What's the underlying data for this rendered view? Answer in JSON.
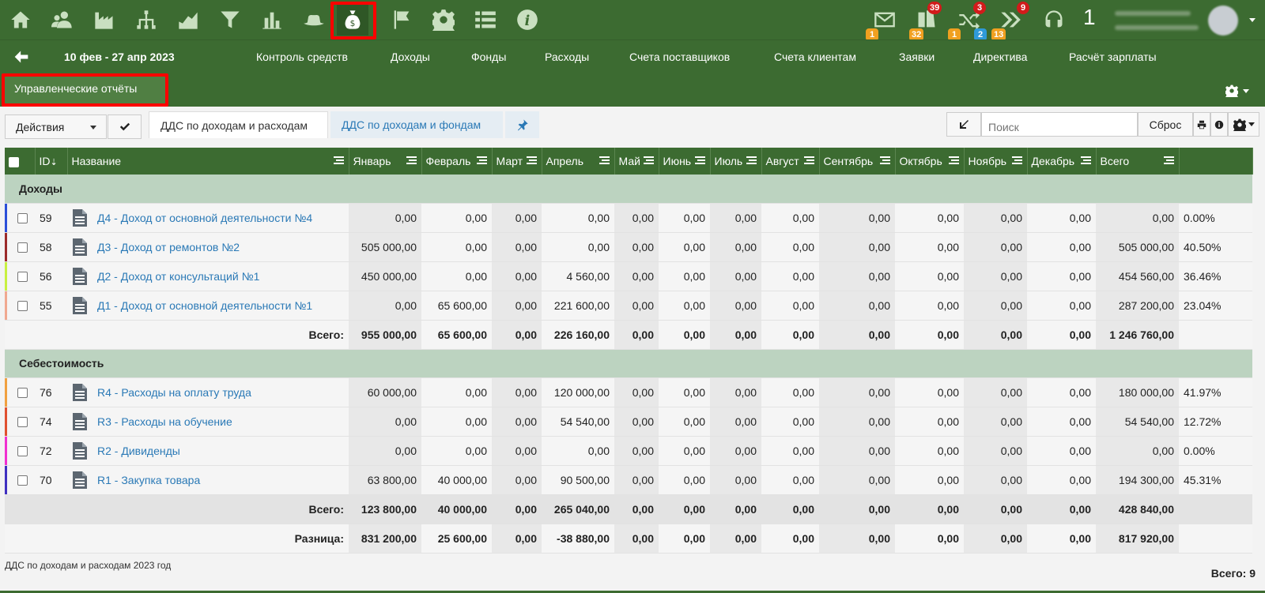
{
  "topbar": {
    "icons": [
      "home-icon",
      "users-icon",
      "factory-icon",
      "org-chart-icon",
      "area-chart-icon",
      "filter-icon",
      "bar-chart-icon",
      "hat-icon",
      "money-bag-icon",
      "flag-icon",
      "gear-icon",
      "list-icon",
      "info-icon"
    ],
    "active_icon": "money-bag-icon",
    "mail_badge": "1",
    "tasks_badge_top": "39",
    "tasks_badge_bottom": "32",
    "shuffle_badge_top": "3",
    "shuffle_badge_left": "1",
    "shuffle_badge_right": "2",
    "forward_badge_top": "9",
    "forward_badge_bottom": "13",
    "count": "1"
  },
  "nav": {
    "daterange": "10 фев - 27 апр 2023",
    "links": [
      "Контроль средств",
      "Доходы",
      "Фонды",
      "Расходы",
      "Счета поставщиков",
      "Счета клиентам",
      "Заявки",
      "Директива",
      "Расчёт зарплаты"
    ]
  },
  "subbar": {
    "tab": "Управленческие отчёты"
  },
  "toolbar": {
    "actions": "Действия",
    "tab1": "ДДС по доходам и расходам",
    "tab2": "ДДС по доходам и фондам",
    "search_placeholder": "Поиск",
    "reset": "Сброс"
  },
  "table": {
    "headers": [
      "ID",
      "Название",
      "Январь",
      "Февраль",
      "Март",
      "Апрель",
      "Май",
      "Июнь",
      "Июль",
      "Август",
      "Сентябрь",
      "Октябрь",
      "Ноябрь",
      "Декабрь",
      "Всего"
    ],
    "groups": [
      {
        "label": "Доходы",
        "rows": [
          {
            "id": "59",
            "name": "Д4 - Доход от основной деятельности №4",
            "color": "#2b4fd8",
            "values": [
              "0,00",
              "0,00",
              "0,00",
              "0,00",
              "0,00",
              "0,00",
              "0,00",
              "0,00",
              "0,00",
              "0,00",
              "0,00",
              "0,00",
              "0,00"
            ],
            "pct": "0.00%"
          },
          {
            "id": "58",
            "name": "Д3 - Доход от ремонтов №2",
            "color": "#9b2a2a",
            "values": [
              "505 000,00",
              "0,00",
              "0,00",
              "0,00",
              "0,00",
              "0,00",
              "0,00",
              "0,00",
              "0,00",
              "0,00",
              "0,00",
              "0,00",
              "505 000,00"
            ],
            "pct": "40.50%"
          },
          {
            "id": "56",
            "name": "Д2 - Доход от консультаций №1",
            "color": "#c8f040",
            "values": [
              "450 000,00",
              "0,00",
              "0,00",
              "4 560,00",
              "0,00",
              "0,00",
              "0,00",
              "0,00",
              "0,00",
              "0,00",
              "0,00",
              "0,00",
              "454 560,00"
            ],
            "pct": "36.46%"
          },
          {
            "id": "55",
            "name": "Д1 - Доход от основной деятельности №1",
            "color": "#f0a890",
            "values": [
              "0,00",
              "65 600,00",
              "0,00",
              "221 600,00",
              "0,00",
              "0,00",
              "0,00",
              "0,00",
              "0,00",
              "0,00",
              "0,00",
              "0,00",
              "287 200,00"
            ],
            "pct": "23.04%"
          }
        ],
        "total_label": "Всего:",
        "total": [
          "955 000,00",
          "65 600,00",
          "0,00",
          "226 160,00",
          "0,00",
          "0,00",
          "0,00",
          "0,00",
          "0,00",
          "0,00",
          "0,00",
          "0,00",
          "1 246 760,00"
        ]
      },
      {
        "label": "Себестоимость",
        "rows": [
          {
            "id": "76",
            "name": "R4 - Расходы на оплату труда",
            "color": "#f0a040",
            "values": [
              "60 000,00",
              "0,00",
              "0,00",
              "120 000,00",
              "0,00",
              "0,00",
              "0,00",
              "0,00",
              "0,00",
              "0,00",
              "0,00",
              "0,00",
              "180 000,00"
            ],
            "pct": "41.97%"
          },
          {
            "id": "74",
            "name": "R3 - Расходы на обучение",
            "color": "#e05030",
            "values": [
              "0,00",
              "0,00",
              "0,00",
              "54 540,00",
              "0,00",
              "0,00",
              "0,00",
              "0,00",
              "0,00",
              "0,00",
              "0,00",
              "0,00",
              "54 540,00"
            ],
            "pct": "12.72%"
          },
          {
            "id": "72",
            "name": "R2 - Дивиденды",
            "color": "#f030d0",
            "values": [
              "0,00",
              "0,00",
              "0,00",
              "0,00",
              "0,00",
              "0,00",
              "0,00",
              "0,00",
              "0,00",
              "0,00",
              "0,00",
              "0,00",
              "0,00"
            ],
            "pct": "0.00%"
          },
          {
            "id": "70",
            "name": "R1 - Закупка товара",
            "color": "#4030c0",
            "values": [
              "63 800,00",
              "40 000,00",
              "0,00",
              "90 500,00",
              "0,00",
              "0,00",
              "0,00",
              "0,00",
              "0,00",
              "0,00",
              "0,00",
              "0,00",
              "194 300,00"
            ],
            "pct": "45.31%"
          }
        ],
        "total_label": "Всего:",
        "total": [
          "123 800,00",
          "40 000,00",
          "0,00",
          "265 040,00",
          "0,00",
          "0,00",
          "0,00",
          "0,00",
          "0,00",
          "0,00",
          "0,00",
          "0,00",
          "428 840,00"
        ]
      }
    ],
    "diff_label": "Разница:",
    "diff": [
      "831 200,00",
      "25 600,00",
      "0,00",
      "-38 880,00",
      "0,00",
      "0,00",
      "0,00",
      "0,00",
      "0,00",
      "0,00",
      "0,00",
      "0,00",
      "817 920,00"
    ]
  },
  "footer": {
    "note": "ДДС по доходам и расходам 2023 год",
    "count": "Всего: 9"
  }
}
